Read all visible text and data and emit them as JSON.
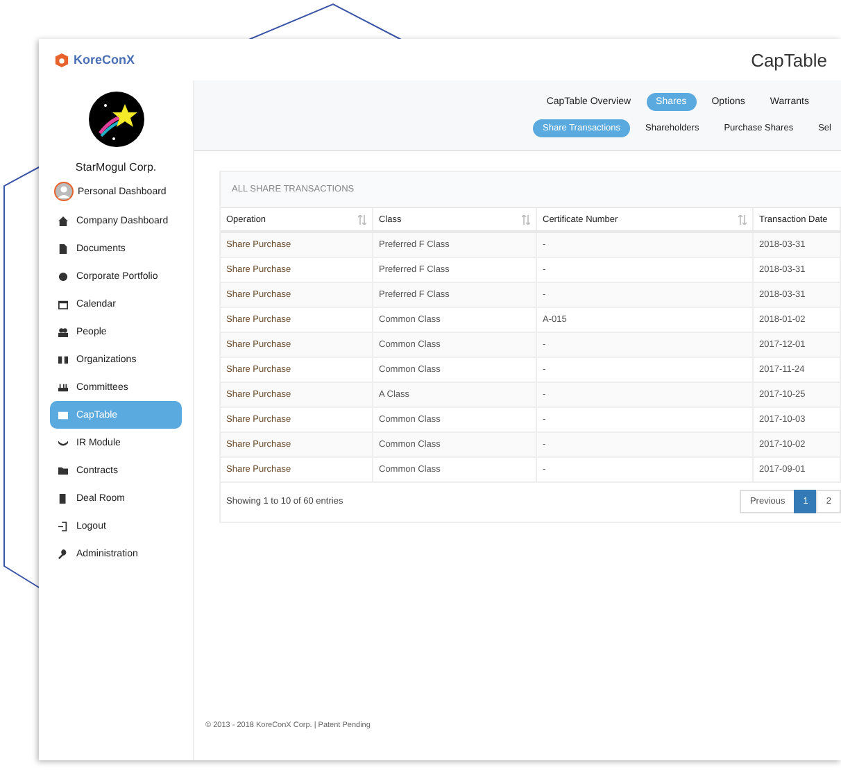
{
  "header": {
    "brand": "KoreConX",
    "page_title": "CapTable"
  },
  "sidebar": {
    "company": "StarMogul Corp.",
    "personal": "Personal Dashboard",
    "items": [
      {
        "label": "Company Dashboard",
        "selected": false
      },
      {
        "label": "Documents",
        "selected": false
      },
      {
        "label": "Corporate Portfolio",
        "selected": false
      },
      {
        "label": "Calendar",
        "selected": false
      },
      {
        "label": "People",
        "selected": false
      },
      {
        "label": "Organizations",
        "selected": false
      },
      {
        "label": "Committees",
        "selected": false
      },
      {
        "label": "CapTable",
        "selected": true
      },
      {
        "label": "IR Module",
        "selected": false
      },
      {
        "label": "Contracts",
        "selected": false
      },
      {
        "label": "Deal Room",
        "selected": false
      },
      {
        "label": "Logout",
        "selected": false
      },
      {
        "label": "Administration",
        "selected": false
      }
    ]
  },
  "tabs": [
    {
      "label": "CapTable Overview",
      "selected": false
    },
    {
      "label": "Shares",
      "selected": true
    },
    {
      "label": "Options",
      "selected": false
    },
    {
      "label": "Warrants",
      "selected": false
    }
  ],
  "subtabs": [
    {
      "label": "Share Transactions",
      "selected": true
    },
    {
      "label": "Shareholders",
      "selected": false
    },
    {
      "label": "Purchase Shares",
      "selected": false
    },
    {
      "label": "Sel",
      "selected": false
    }
  ],
  "table": {
    "title": "ALL SHARE TRANSACTIONS",
    "columns": [
      {
        "label": "Operation",
        "sortable": true
      },
      {
        "label": "Class",
        "sortable": true
      },
      {
        "label": "Certificate Number",
        "sortable": true
      },
      {
        "label": "Transaction Date",
        "sortable": false
      }
    ],
    "rows": [
      [
        "Share Purchase",
        "Preferred F Class",
        "-",
        "2018-03-31"
      ],
      [
        "Share Purchase",
        "Preferred F Class",
        "-",
        "2018-03-31"
      ],
      [
        "Share Purchase",
        "Preferred F Class",
        "-",
        "2018-03-31"
      ],
      [
        "Share Purchase",
        "Common Class",
        "A-015",
        "2018-01-02"
      ],
      [
        "Share Purchase",
        "Common Class",
        "-",
        "2017-12-01"
      ],
      [
        "Share Purchase",
        "Common Class",
        "-",
        "2017-11-24"
      ],
      [
        "Share Purchase",
        "A Class",
        "-",
        "2017-10-25"
      ],
      [
        "Share Purchase",
        "Common Class",
        "-",
        "2017-10-03"
      ],
      [
        "Share Purchase",
        "Common Class",
        "-",
        "2017-10-02"
      ],
      [
        "Share Purchase",
        "Common Class",
        "-",
        "2017-09-01"
      ]
    ],
    "info": "Showing 1 to 10 of 60 entries",
    "pagination": [
      {
        "label": "Previous",
        "selected": false
      },
      {
        "label": "1",
        "selected": true
      },
      {
        "label": "2",
        "selected": false
      }
    ]
  },
  "footer": "© 2013 - 2018 KoreConX Corp. | Patent Pending"
}
